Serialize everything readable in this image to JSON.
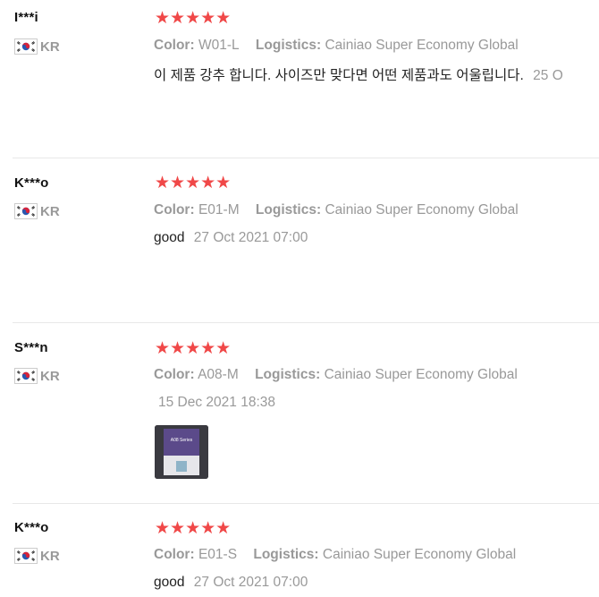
{
  "reviews": [
    {
      "user": "I***i",
      "country": "KR",
      "stars": "★★★★★",
      "color_label": "Color:",
      "color_value": "W01-L",
      "logistics_label": "Logistics:",
      "logistics_value": "Cainiao Super Economy Global",
      "text": "이 제품 강추 합니다. 사이즈만 맞다면 어떤 제품과도 어울립니다.",
      "date": "25 O"
    },
    {
      "user": "K***o",
      "country": "KR",
      "stars": "★★★★★",
      "color_label": "Color:",
      "color_value": "E01-M",
      "logistics_label": "Logistics:",
      "logistics_value": "Cainiao Super Economy Global",
      "text": "good",
      "date": "27 Oct 2021 07:00"
    },
    {
      "user": "S***n",
      "country": "KR",
      "stars": "★★★★★",
      "color_label": "Color:",
      "color_value": "A08-M",
      "logistics_label": "Logistics:",
      "logistics_value": "Cainiao Super Economy Global",
      "text": "",
      "date": "15 Dec 2021 18:38",
      "photo_text": "A08 Series"
    },
    {
      "user": "K***o",
      "country": "KR",
      "stars": "★★★★★",
      "color_label": "Color:",
      "color_value": "E01-S",
      "logistics_label": "Logistics:",
      "logistics_value": "Cainiao Super Economy Global",
      "text": "good",
      "date": "27 Oct 2021 07:00"
    }
  ],
  "colors": {
    "star": "#f04848",
    "muted": "#999999",
    "divider": "#e8e8e8"
  }
}
